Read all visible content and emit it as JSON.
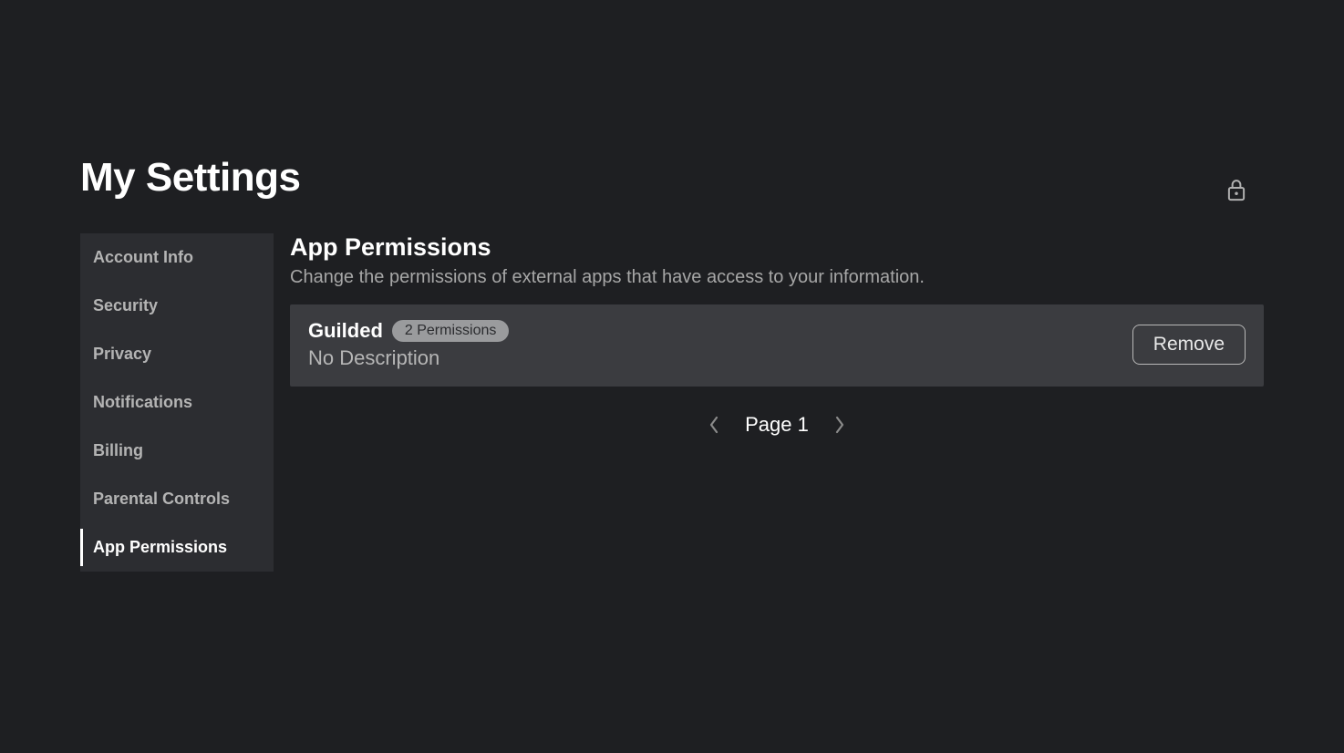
{
  "page_title": "My Settings",
  "sidebar": {
    "items": [
      {
        "label": "Account Info",
        "id": "account-info",
        "active": false
      },
      {
        "label": "Security",
        "id": "security",
        "active": false
      },
      {
        "label": "Privacy",
        "id": "privacy",
        "active": false
      },
      {
        "label": "Notifications",
        "id": "notifications",
        "active": false
      },
      {
        "label": "Billing",
        "id": "billing",
        "active": false
      },
      {
        "label": "Parental Controls",
        "id": "parental-controls",
        "active": false
      },
      {
        "label": "App Permissions",
        "id": "app-permissions",
        "active": true
      }
    ]
  },
  "main": {
    "heading": "App Permissions",
    "subtitle": "Change the permissions of external apps that have access to your information.",
    "apps": [
      {
        "name": "Guilded",
        "badge": "2 Permissions",
        "description": "No Description",
        "remove_label": "Remove"
      }
    ],
    "pagination": {
      "label": "Page 1"
    }
  }
}
